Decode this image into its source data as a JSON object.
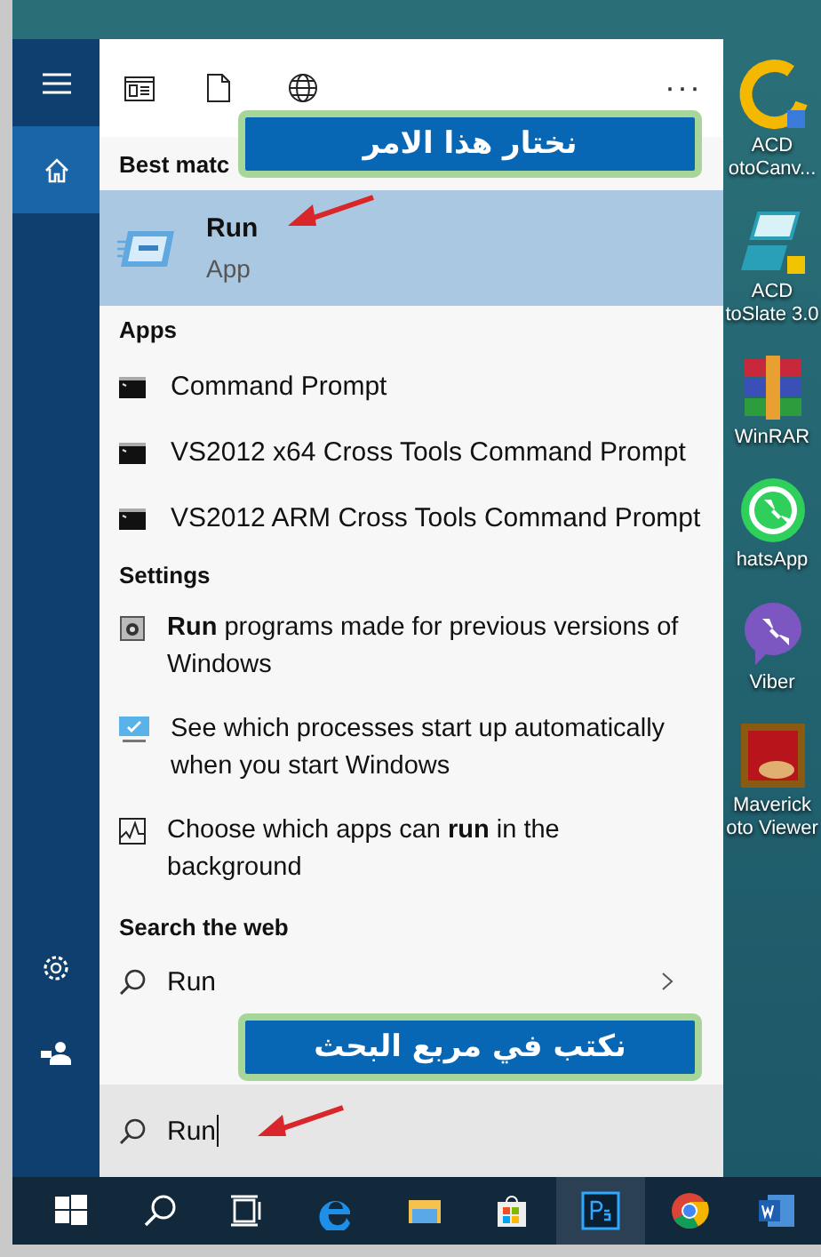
{
  "sidebar": {
    "items": [
      {
        "kind": "menu",
        "selected": false
      },
      {
        "kind": "home",
        "selected": true
      },
      {
        "kind": "settings",
        "selected": false
      },
      {
        "kind": "user",
        "selected": false
      }
    ]
  },
  "toolbar": {
    "tabs": [
      {
        "kind": "apps"
      },
      {
        "kind": "documents"
      },
      {
        "kind": "web"
      }
    ],
    "more": "···"
  },
  "best_match": {
    "heading": "Best matc",
    "item": {
      "title": "Run",
      "subtitle": "App",
      "selected": true
    }
  },
  "apps": {
    "heading": "Apps",
    "items": [
      {
        "label": "Command Prompt"
      },
      {
        "label": "VS2012 x64 Cross Tools Command Prompt"
      },
      {
        "label": "VS2012 ARM Cross Tools Command Prompt"
      }
    ]
  },
  "settings": {
    "heading": "Settings",
    "items": [
      {
        "kind": "compat",
        "text": "**Run** programs made for previous versions of Windows"
      },
      {
        "kind": "startup",
        "text": "See which processes start up automatically when you start Windows"
      },
      {
        "kind": "background",
        "text": "Choose which apps can **run** in the background"
      }
    ]
  },
  "web": {
    "heading": "Search the web",
    "items": [
      {
        "text": "Run"
      }
    ]
  },
  "search": {
    "value": "Run"
  },
  "callouts": [
    {
      "text": "نختار هذا الامر"
    },
    {
      "text": "نكتب في مربع البحث"
    }
  ],
  "desktop_icons": [
    {
      "kind": "acd-canvas",
      "lines": [
        "ACD",
        "otoCanv..."
      ]
    },
    {
      "kind": "acd-slate",
      "lines": [
        "ACD",
        "toSlate 3.0"
      ]
    },
    {
      "kind": "winrar",
      "lines": [
        "WinRAR"
      ]
    },
    {
      "kind": "whatsapp",
      "lines": [
        "hatsApp"
      ]
    },
    {
      "kind": "viber",
      "lines": [
        "Viber"
      ]
    },
    {
      "kind": "maverick",
      "lines": [
        "Maverick",
        "oto Viewer"
      ]
    }
  ],
  "taskbar": {
    "items": [
      {
        "kind": "windows",
        "selected": false
      },
      {
        "kind": "search",
        "selected": false
      },
      {
        "kind": "taskview",
        "selected": false
      },
      {
        "kind": "edge",
        "selected": false
      },
      {
        "kind": "explorer",
        "selected": false
      },
      {
        "kind": "store",
        "selected": false
      },
      {
        "kind": "photoshop",
        "selected": true
      },
      {
        "kind": "chrome",
        "selected": false
      },
      {
        "kind": "word",
        "selected": false
      }
    ]
  }
}
